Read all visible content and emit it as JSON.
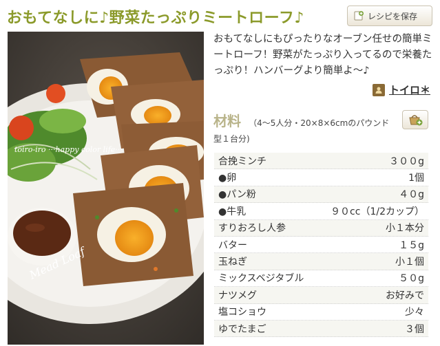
{
  "recipe": {
    "title": "おもてなしに♪野菜たっぷりミートローフ♪",
    "save_label": "レシピを保存",
    "description": "おもてなしにもぴったりなオーブン任せの簡単ミートローフ！野菜がたっぷり入ってるので栄養たっぷり！ハンバーグより簡単よ〜♪",
    "author": "トイロ＊",
    "photo_text": {
      "watermark": "toiro-iro ···happy color life···",
      "caption": "Mead Loaf"
    }
  },
  "ingredients": {
    "title": "材料",
    "note_line1": "（4〜5人分・20×8×6cmのパウンド",
    "note_line2": "型１台分)",
    "rows": [
      {
        "name": "合挽ミンチ",
        "qty": "３００g"
      },
      {
        "name": "●卵",
        "qty": "1個"
      },
      {
        "name": "●パン粉",
        "qty": "４０g"
      },
      {
        "name": "●牛乳",
        "qty": "９０cc（1/2カップ）"
      },
      {
        "name": "すりおろし人参",
        "qty": "小１本分"
      },
      {
        "name": "バター",
        "qty": "１５g"
      },
      {
        "name": "玉ねぎ",
        "qty": "小１個"
      },
      {
        "name": "ミックスベジタブル",
        "qty": "５０g"
      },
      {
        "name": "ナツメグ",
        "qty": "お好みで"
      },
      {
        "name": "塩コショウ",
        "qty": "少々"
      },
      {
        "name": "ゆでたまご",
        "qty": "３個"
      }
    ]
  },
  "colors": {
    "title": "#8b9a2a",
    "section": "#b9b48a"
  },
  "icons": {
    "save": "bookmark-plus-icon",
    "basket": "basket-add-icon",
    "author": "user-avatar-icon"
  }
}
